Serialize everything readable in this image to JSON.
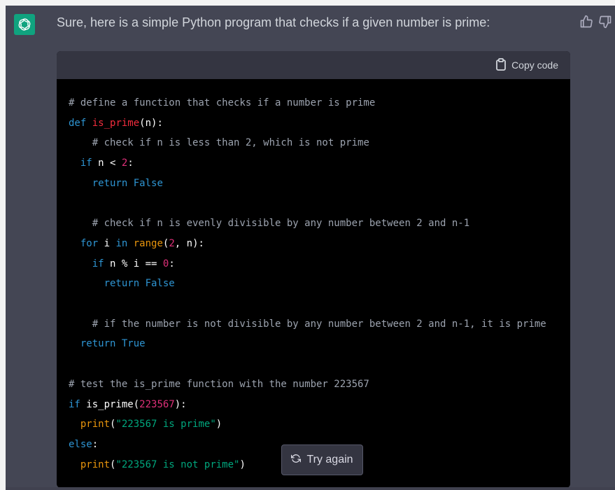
{
  "message": {
    "text": "Sure, here is a simple Python program that checks if a given number is prime:"
  },
  "avatar": {
    "icon": "openai-logo-icon"
  },
  "feedback": {
    "up_icon": "thumbs-up-icon",
    "down_icon": "thumbs-down-icon"
  },
  "code_block": {
    "copy_label": "Copy code",
    "copy_icon": "clipboard-icon",
    "lines": [
      "# define a function that checks if a number is prime",
      "def is_prime(n):",
      "  # check if n is less than 2, which is not prime",
      "  if n < 2:",
      "    return False",
      "",
      "  # check if n is evenly divisible by any number between 2 and n-1",
      "  for i in range(2, n):",
      "    if n % i == 0:",
      "      return False",
      "",
      "  # if the number is not divisible by any number between 2 and n-1, it is prime",
      "  return True",
      "",
      "# test the is_prime function with the number 223567",
      "if is_prime(223567):",
      "  print(\"223567 is prime\")",
      "else:",
      "  print(\"223567 is not prime\")"
    ]
  },
  "try_again": {
    "label": "Try again",
    "icon": "refresh-icon"
  },
  "colors": {
    "chat_bg": "#444654",
    "code_bg": "#000000",
    "code_header": "#343541",
    "accent": "#10a37f",
    "keyword": "#2e95d3",
    "function": "#f22c3d",
    "number": "#df3079",
    "string": "#00a67d",
    "builtin": "#e9950c",
    "comment": "#9ca3af"
  }
}
